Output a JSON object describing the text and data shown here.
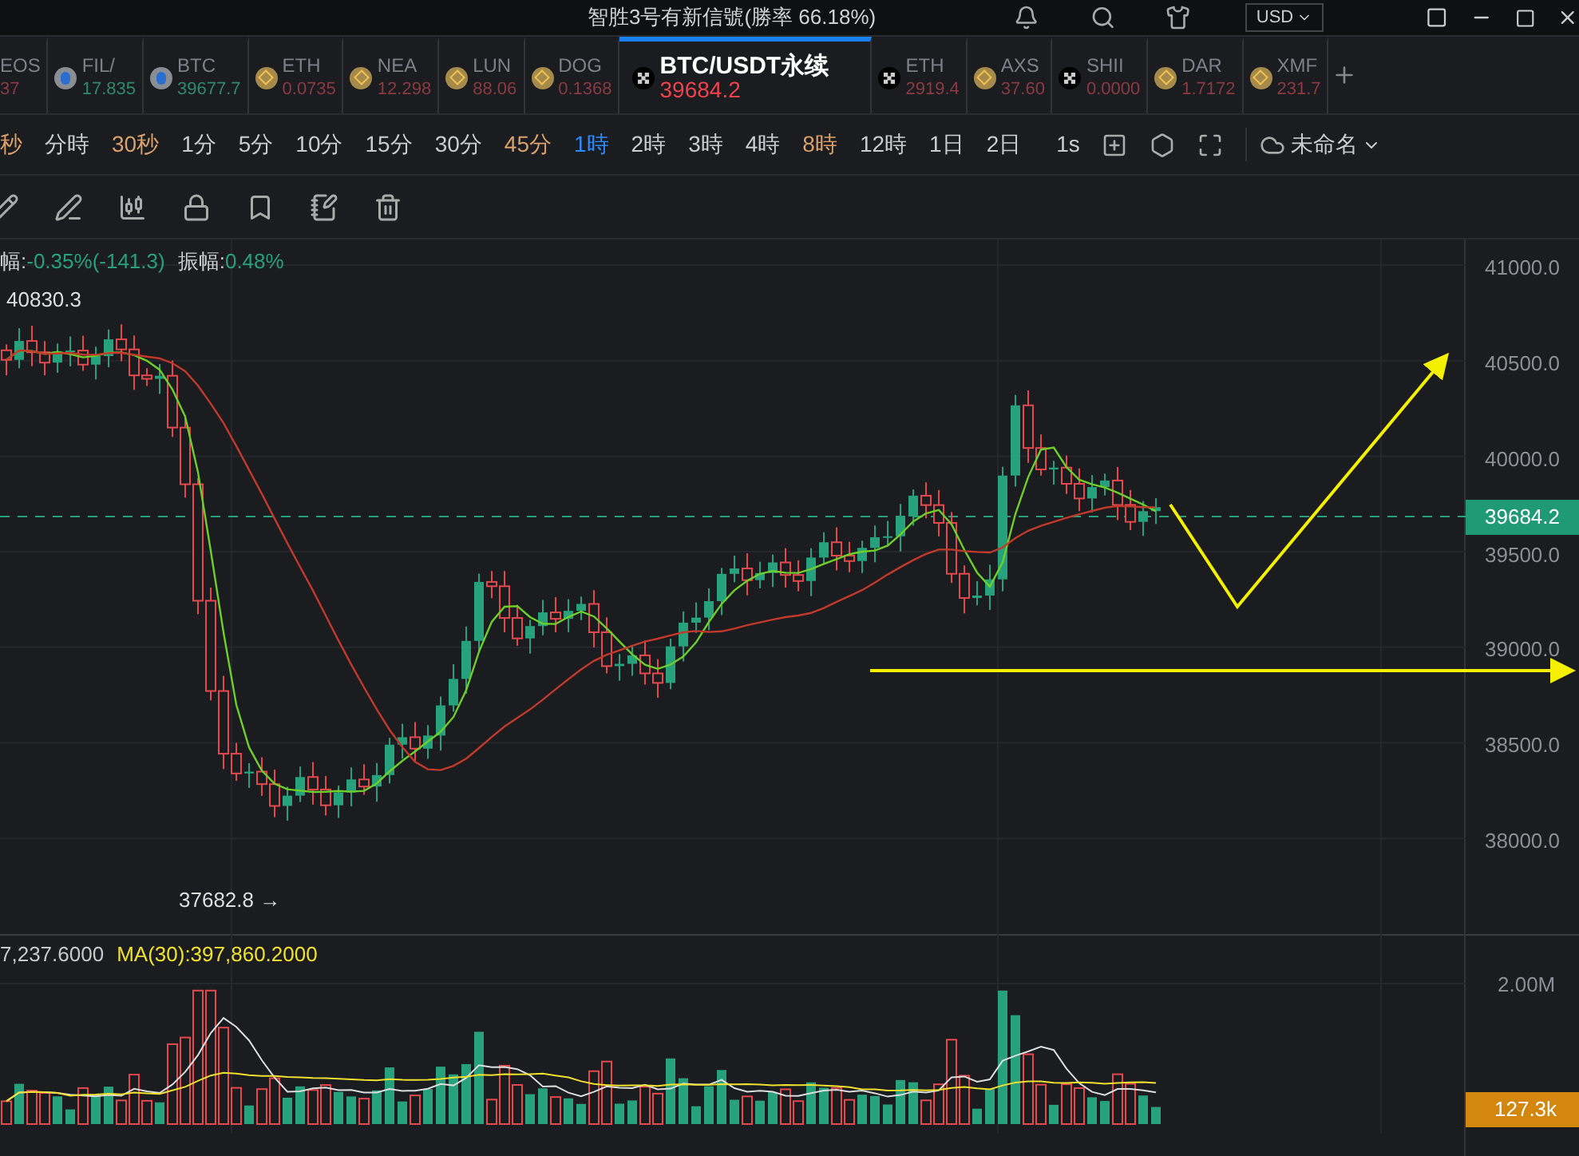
{
  "title_bar": {
    "title": "智胜3号有新信號(勝率 66.18%)",
    "currency": "USD"
  },
  "tickers": [
    {
      "symbol": "EOS",
      "price": "37",
      "kind": "plain",
      "rising": false,
      "selected": false
    },
    {
      "symbol": "FIL/",
      "price": "17.835",
      "kind": "drop",
      "rising": true,
      "selected": false
    },
    {
      "symbol": "BTC",
      "price": "39677.7",
      "kind": "drop",
      "rising": true,
      "selected": false
    },
    {
      "symbol": "ETH",
      "price": "0.0735",
      "kind": "diamond",
      "rising": false,
      "selected": false
    },
    {
      "symbol": "NEA",
      "price": "12.298",
      "kind": "diamond",
      "rising": false,
      "selected": false
    },
    {
      "symbol": "LUN",
      "price": "88.06",
      "kind": "diamond",
      "rising": false,
      "selected": false
    },
    {
      "symbol": "DOG",
      "price": "0.1368",
      "kind": "diamond",
      "rising": false,
      "selected": false
    },
    {
      "symbol": "BTC/USDT永续",
      "price": "39684.2",
      "kind": "checker",
      "rising": false,
      "selected": true
    },
    {
      "symbol": "ETH",
      "price": "2919.4",
      "kind": "checker",
      "rising": false,
      "selected": false
    },
    {
      "symbol": "AXS",
      "price": "37.60",
      "kind": "diamond",
      "rising": false,
      "selected": false
    },
    {
      "symbol": "SHII",
      "price": "0.0000",
      "kind": "checker",
      "rising": false,
      "selected": false
    },
    {
      "symbol": "DAR",
      "price": "1.7172",
      "kind": "diamond",
      "rising": false,
      "selected": false
    },
    {
      "symbol": "XMF",
      "price": "231.7",
      "kind": "diamond",
      "rising": false,
      "selected": false
    }
  ],
  "timeframes": [
    {
      "label": "秒",
      "selected": false,
      "starred": true
    },
    {
      "label": "分時",
      "selected": false,
      "starred": false
    },
    {
      "label": "30秒",
      "selected": false,
      "starred": true
    },
    {
      "label": "1分",
      "selected": false,
      "starred": false
    },
    {
      "label": "5分",
      "selected": false,
      "starred": false
    },
    {
      "label": "10分",
      "selected": false,
      "starred": false
    },
    {
      "label": "15分",
      "selected": false,
      "starred": false
    },
    {
      "label": "30分",
      "selected": false,
      "starred": false
    },
    {
      "label": "45分",
      "selected": false,
      "starred": true
    },
    {
      "label": "1時",
      "selected": true,
      "starred": false
    },
    {
      "label": "2時",
      "selected": false,
      "starred": false
    },
    {
      "label": "3時",
      "selected": false,
      "starred": false
    },
    {
      "label": "4時",
      "selected": false,
      "starred": false
    },
    {
      "label": "8時",
      "selected": false,
      "starred": true
    },
    {
      "label": "12時",
      "selected": false,
      "starred": false
    },
    {
      "label": "1日",
      "selected": false,
      "starred": false
    },
    {
      "label": "2日",
      "selected": false,
      "starred": false
    }
  ],
  "interval": "1s",
  "layout_name": "未命名",
  "chart": {
    "stats": [
      {
        "label": "幅:",
        "value": "-0.35%(-141.3)"
      },
      {
        "label": "振幅:",
        "value": "0.48%"
      }
    ],
    "high_mark": "40830.3",
    "low_mark": "37682.8 →",
    "price_labels": [
      "41000.0",
      "40500.0",
      "40000.0",
      "39500.0",
      "39000.0",
      "38500.0",
      "38000.0"
    ],
    "current_price": "39684.2",
    "volume_header": [
      {
        "text": "7,237.6000",
        "color": "#c8c8c8"
      },
      {
        "text": "MA(30):397,860.2000",
        "color": "#f0e130"
      }
    ],
    "volume_label": "2.00M",
    "current_volume": "127.3k"
  }
}
